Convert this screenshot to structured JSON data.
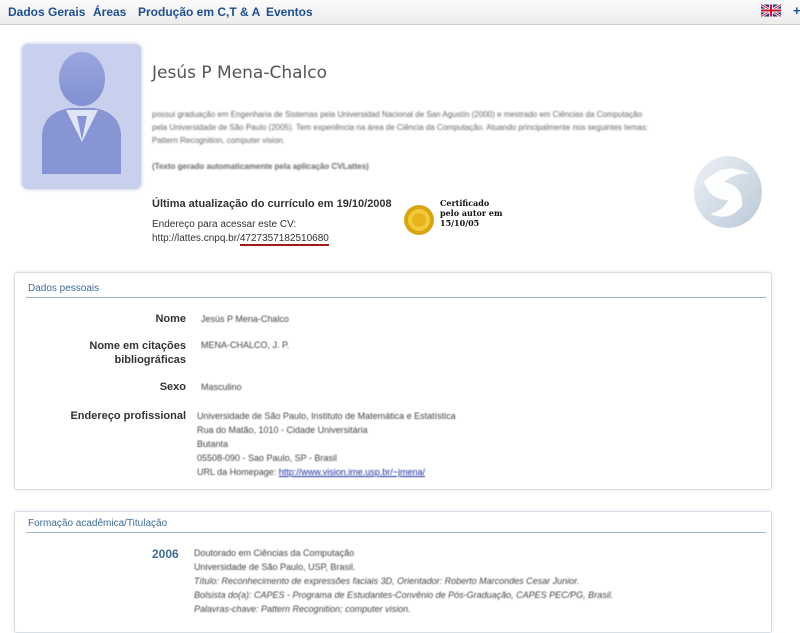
{
  "nav": {
    "items": [
      "Dados Gerais",
      "Áreas",
      "Produção em C,T & A",
      "Eventos"
    ],
    "extra": "+"
  },
  "profile": {
    "name": "Jesús P Mena-Chalco",
    "summary": "possui graduação em Engenharia de Sistemas pela Universidad Nacional de San Agustín (2000) e mestrado em Ciências da Computação pela Universidade de São Paulo (2005). Tem experiência na área de Ciência da Computação. Atuando principalmente nos seguintes temas: Pattern Recognition, computer vision.",
    "summary_note": "(Texto gerado automaticamente pela aplicação CVLattes)",
    "last_update": "Última atualização do currículo em 19/10/2008",
    "address_label": "Endereço para acessar este CV:",
    "address_prefix": "http://lattes.cnpq.br/",
    "address_id": "4727357182510680",
    "certificate": [
      "Certificado",
      "pelo autor em",
      "15/10/05"
    ]
  },
  "personal": {
    "title": "Dados pessoais",
    "fields": [
      {
        "label": "Nome",
        "value": [
          "Jesús P Mena-Chalco"
        ]
      },
      {
        "label": "Nome em citações bibliográficas",
        "value": [
          "MENA-CHALCO, J. P."
        ]
      },
      {
        "label": "Sexo",
        "value": [
          "Masculino"
        ]
      },
      {
        "label": "Endereço profissional",
        "value": [
          "Universidade de São Paulo, Instituto de Matemática e Estatística",
          "Rua do Matão, 1010 - Cidade Universitária",
          "Butanta",
          "05508-090 - Sao Paulo, SP - Brasil"
        ]
      }
    ],
    "homepage_label": "URL da Homepage:",
    "homepage_url": "http://www.vision.ime.usp.br/~jmena/"
  },
  "education": {
    "title": "Formação acadêmica/Titulação",
    "entries": [
      {
        "year": "2006",
        "lines": [
          "Doutorado em Ciências da Computação",
          "Universidade de São Paulo, USP, Brasil.",
          "Título: Reconhecimento de expressões faciais 3D, Orientador: Roberto Marcondes Cesar Junior.",
          "Bolsista do(a): CAPES - Programa de Estudantes-Convênio de Pós-Graduação, CAPES PEC/PG, Brasil.",
          "Palavras-chave: Pattern Recognition; computer vision."
        ]
      }
    ]
  },
  "colors": {
    "nav_text": "#1d4f91",
    "section_title": "#3f6c96",
    "underline": "#a01818",
    "link": "#1b2fa0"
  },
  "icons": [
    "uk-flag-icon",
    "avatar-placeholder-icon",
    "certificate-seal-icon",
    "lattes-logo-icon"
  ]
}
